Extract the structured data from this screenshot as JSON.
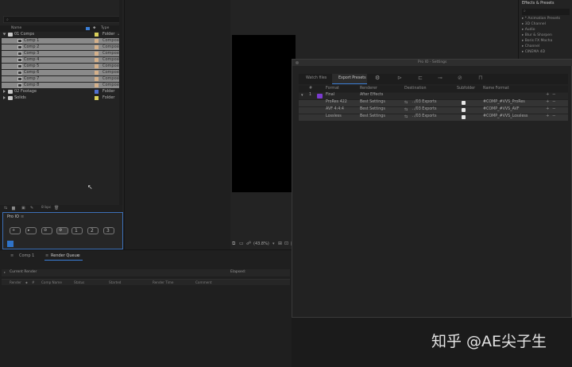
{
  "project": {
    "search_placeholder": "",
    "columns": {
      "name": "Name",
      "type": "Type"
    },
    "items": [
      {
        "name": "01 Comps",
        "type": "Folder",
        "kind": "folder",
        "color": "#d8cf5a",
        "selected": false,
        "depth": 0,
        "open": true
      },
      {
        "name": "Comp 1",
        "type": "Composit",
        "kind": "comp",
        "color": "#d4b08a",
        "selected": true,
        "depth": 1
      },
      {
        "name": "Comp 2",
        "type": "Composit",
        "kind": "comp",
        "color": "#d4b08a",
        "selected": true,
        "depth": 1
      },
      {
        "name": "Comp 3",
        "type": "Composit",
        "kind": "comp",
        "color": "#d4b08a",
        "selected": true,
        "depth": 1
      },
      {
        "name": "Comp 4",
        "type": "Composit",
        "kind": "comp",
        "color": "#d4b08a",
        "selected": true,
        "depth": 1
      },
      {
        "name": "Comp 5",
        "type": "Composit",
        "kind": "comp",
        "color": "#d4b08a",
        "selected": true,
        "depth": 1
      },
      {
        "name": "Comp 6",
        "type": "Composit",
        "kind": "comp",
        "color": "#d4b08a",
        "selected": true,
        "depth": 1
      },
      {
        "name": "Comp 7",
        "type": "Composit",
        "kind": "comp",
        "color": "#d4b08a",
        "selected": true,
        "depth": 1
      },
      {
        "name": "Comp 8",
        "type": "Composit",
        "kind": "comp",
        "color": "#d4b08a",
        "selected": true,
        "depth": 1
      },
      {
        "name": "02 Footage",
        "type": "Folder",
        "kind": "folder",
        "color": "#4f6fd0",
        "selected": false,
        "depth": 0
      },
      {
        "name": "Solids",
        "type": "Folder",
        "kind": "folder",
        "color": "#d8cf5a",
        "selected": false,
        "depth": 0
      }
    ],
    "footer_bpc": "8 bpc"
  },
  "proio": {
    "title": "Pro IO",
    "buttons": [
      {
        "icon": "watch-add-icon",
        "label": ""
      },
      {
        "icon": "export-icon",
        "label": ""
      },
      {
        "icon": "skip-icon",
        "label": ""
      },
      {
        "icon": "settings-icon",
        "label": ""
      },
      {
        "icon": "preset-1-icon",
        "label": "1"
      },
      {
        "icon": "preset-2-icon",
        "label": "2"
      },
      {
        "icon": "preset-3-icon",
        "label": "3"
      }
    ]
  },
  "viewer": {
    "zoom": "(43.8%)"
  },
  "effects": {
    "title": "Effects & Presets",
    "items": [
      "* Animation Presets",
      "3D Channel",
      "Audio",
      "Blur & Sharpen",
      "Boris FX Mocha",
      "Channel",
      "CINEMA 4D"
    ]
  },
  "dialog": {
    "title": "Pro IO - Settings",
    "tabs": [
      "Watch files",
      "Export Presets"
    ],
    "active_tab": "Export Presets",
    "table": {
      "columns": [
        "#",
        "Format",
        "Renderer",
        "Destination",
        "Subfolder",
        "Name Format"
      ],
      "group": {
        "index": "1",
        "format": "Final",
        "renderer": "After Effects"
      },
      "rows": [
        {
          "format": "ProRes 422",
          "renderer": "Best Settings",
          "destination": "../03 Exports",
          "name_format": "#COMP_#VVS_ProRes"
        },
        {
          "format": "AVF 4:4:4",
          "renderer": "Best Settings",
          "destination": "../03 Exports",
          "name_format": "#COMP_#VVS_AVF"
        },
        {
          "format": "Lossless",
          "renderer": "Best Settings",
          "destination": "../03 Exports",
          "name_format": "#COMP_#VVS_Lossless"
        }
      ]
    }
  },
  "bottom": {
    "tabs": [
      "Comp 1",
      "Render Queue"
    ],
    "current_render": "Current Render",
    "elapsed": "Elapsed:",
    "columns": [
      "Render",
      "#",
      "Comp Name",
      "Status",
      "Started",
      "Render Time",
      "Comment"
    ]
  },
  "watermark": "知乎 @AE尖子生"
}
